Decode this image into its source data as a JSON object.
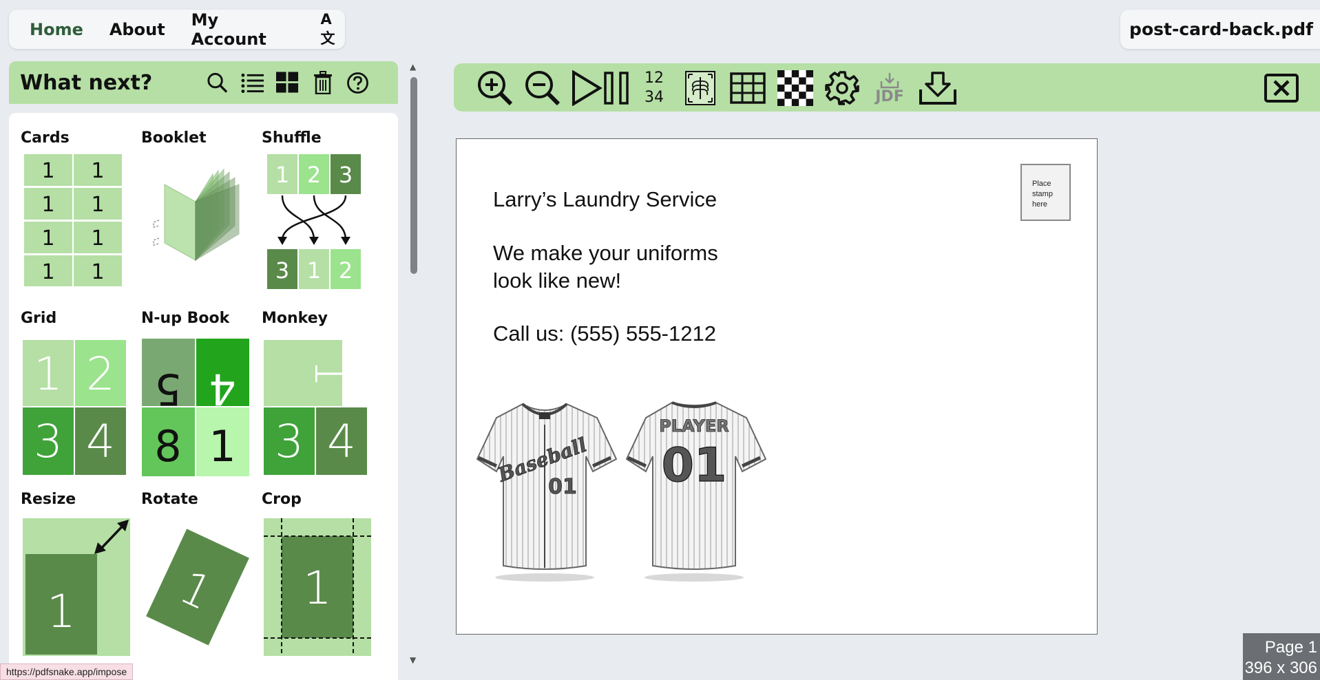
{
  "nav": {
    "items": [
      "Home",
      "About",
      "My Account"
    ],
    "lang_label": "A文"
  },
  "document": {
    "filename": "post-card-back.pdf"
  },
  "whatnext": {
    "title": "What next?",
    "icons": [
      "search-icon",
      "list-icon",
      "grid-icon",
      "trash-icon",
      "help-icon"
    ]
  },
  "tiles": [
    {
      "label": "Cards"
    },
    {
      "label": "Booklet"
    },
    {
      "label": "Shuffle"
    },
    {
      "label": "Grid"
    },
    {
      "label": "N-up Book"
    },
    {
      "label": "Monkey"
    },
    {
      "label": "Resize"
    },
    {
      "label": "Rotate"
    },
    {
      "label": "Crop"
    }
  ],
  "tile_digits": {
    "cards": [
      "1",
      "1",
      "1",
      "1",
      "1",
      "1",
      "1",
      "1"
    ],
    "shuffle_top": [
      "1",
      "2",
      "3"
    ],
    "shuffle_bottom": [
      "3",
      "1",
      "2"
    ],
    "grid": [
      "1",
      "2",
      "3",
      "4"
    ],
    "nup": [
      "5",
      "4",
      "8",
      "1"
    ],
    "monkey": [
      "1",
      "3",
      "4"
    ],
    "resize": "1",
    "rotate": "1",
    "crop": "1"
  },
  "toolbar": {
    "page_numbers_top": "12",
    "page_numbers_bottom": "34",
    "jdf_label": "JDF",
    "icons": [
      "zoom-in-icon",
      "zoom-out-icon",
      "play-pause-icon",
      "page-numbers-icon",
      "xray-icon",
      "table-icon",
      "checker-icon",
      "settings-icon",
      "jdf-icon",
      "download-icon",
      "close-icon"
    ]
  },
  "postcard": {
    "company": "Larry’s Laundry Service",
    "tagline_line1": "We make your uniforms",
    "tagline_line2": "look like new!",
    "phone": "Call us: (555) 555-1212",
    "stamp_line1": "Place",
    "stamp_line2": "stamp",
    "stamp_line3": "here",
    "jersey1_script": "Baseball",
    "jersey1_number": "01",
    "jersey2_name": "PLAYER",
    "jersey2_number": "01"
  },
  "page_info": {
    "page_label": "Page 1",
    "size_label": "396 x 306"
  },
  "status": {
    "url": "https://pdfsnake.app/impose"
  },
  "colors": {
    "accent_green": "#b5dfa5",
    "dark_green": "#5a8a4a",
    "mid_green": "#3fa33a",
    "light_green": "#a8d89a"
  }
}
